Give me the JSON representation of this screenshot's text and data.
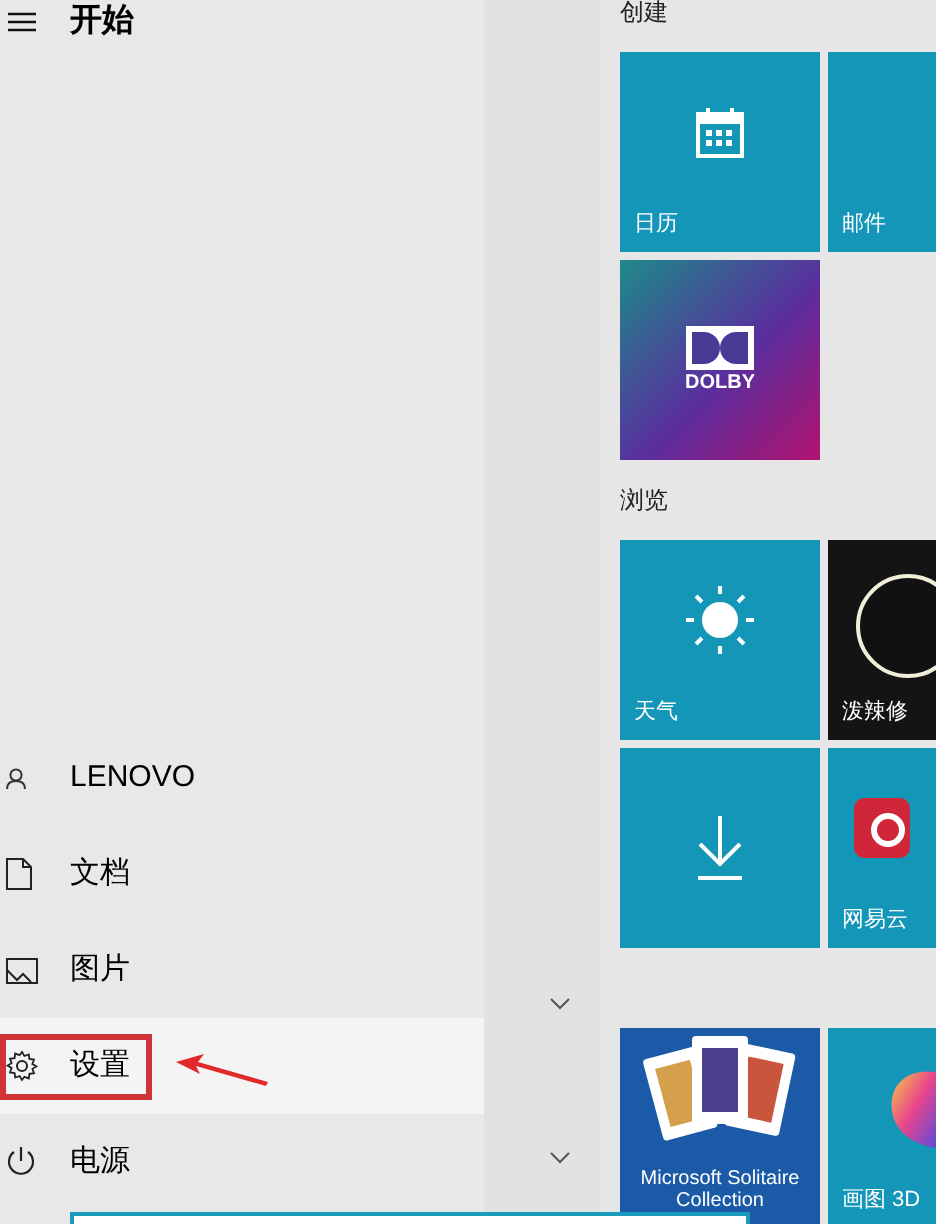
{
  "header": {
    "title": "开始"
  },
  "nav_items": [
    {
      "kind": "user",
      "label": "LENOVO",
      "selected": false,
      "highlighted": false
    },
    {
      "kind": "documents",
      "label": "文档",
      "selected": false,
      "highlighted": false
    },
    {
      "kind": "pictures",
      "label": "图片",
      "selected": false,
      "highlighted": false
    },
    {
      "kind": "settings",
      "label": "设置",
      "selected": true,
      "highlighted": true
    },
    {
      "kind": "power",
      "label": "电源",
      "selected": false,
      "highlighted": false
    }
  ],
  "tile_groups": [
    {
      "label": "创建",
      "tiles": [
        {
          "kind": "calendar",
          "label": "日历"
        },
        {
          "kind": "mail",
          "label": "邮件"
        },
        {
          "kind": "dolby",
          "label": "DOLBY"
        }
      ]
    },
    {
      "label": "浏览",
      "tiles": [
        {
          "kind": "weather",
          "label": "天气"
        },
        {
          "kind": "photo",
          "label": "泼辣修"
        },
        {
          "kind": "download"
        },
        {
          "kind": "music",
          "label": "网易云"
        }
      ]
    },
    {
      "tiles": [
        {
          "kind": "cards",
          "label": "Microsoft Solitaire Collection"
        },
        {
          "kind": "paint",
          "label": "画图 3D"
        }
      ]
    }
  ]
}
